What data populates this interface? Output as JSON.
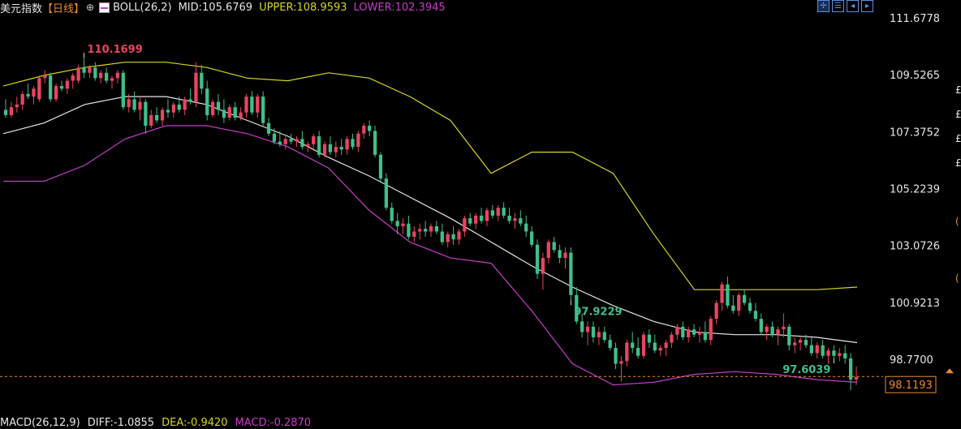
{
  "header": {
    "title": "美元指数",
    "period": "【日线】",
    "settings_icon": "settings-icon",
    "boll_icon": "boll-indicator-icon",
    "boll_label": "BOLL(26,2)",
    "mid": "MID:105.6769",
    "upper": "UPPER:108.9593",
    "lower": "LOWER:102.3945"
  },
  "toolbar": {
    "icons": [
      "crosshair-icon",
      "chart-layout-icon",
      "prev-chart-icon",
      "next-chart-icon"
    ]
  },
  "footer": {
    "macd_label": "MACD(26,12,9)",
    "diff": "DIFF:-1.0855",
    "dea": "DEA:-0.9420",
    "macd": "MACD:-0.2870"
  },
  "right_edge_glyphs": [
    "£",
    "£",
    "£",
    "£",
    "(",
    "("
  ],
  "colors": {
    "background": "#000000",
    "up_candle": "#e8455e",
    "down_candle": "#3fbf8c",
    "mid_line": "#e6e6e6",
    "upper_line": "#d8d520",
    "lower_line": "#c83cc8",
    "axis_text": "#e6e6e6",
    "high_label": "#e8455e",
    "low_label": "#3fbf8c",
    "current_price": "#e88a2a"
  },
  "chart_data": {
    "type": "candlestick",
    "y_ticks": [
      "111.6778",
      "109.5265",
      "107.3752",
      "105.2239",
      "103.0726",
      "100.9213",
      "98.7700"
    ],
    "ylim": [
      97.6,
      111.7
    ],
    "grid": false,
    "current_price": "98.1193",
    "annotations": [
      {
        "label": "110.1699",
        "bar": 14,
        "kind": "high"
      },
      {
        "label": "97.9229",
        "bar": 101,
        "kind": "low"
      },
      {
        "label": "97.6039",
        "bar": 148,
        "kind": "low"
      }
    ],
    "candles_ohlc": [
      [
        108.2,
        108.6,
        107.9,
        108.0
      ],
      [
        108.0,
        108.5,
        107.9,
        108.3
      ],
      [
        108.3,
        108.7,
        108.1,
        108.4
      ],
      [
        108.4,
        108.9,
        108.2,
        108.8
      ],
      [
        108.8,
        109.2,
        108.6,
        108.7
      ],
      [
        108.7,
        109.1,
        108.4,
        109.0
      ],
      [
        108.6,
        109.5,
        108.5,
        109.4
      ],
      [
        109.4,
        109.7,
        109.2,
        109.5
      ],
      [
        109.5,
        109.6,
        108.5,
        108.6
      ],
      [
        108.6,
        109.2,
        108.5,
        109.1
      ],
      [
        109.1,
        109.3,
        108.9,
        109.0
      ],
      [
        109.0,
        109.4,
        108.8,
        109.3
      ],
      [
        109.3,
        109.6,
        109.0,
        109.5
      ],
      [
        109.3,
        109.9,
        109.2,
        109.8
      ],
      [
        109.8,
        110.17,
        109.4,
        109.6
      ],
      [
        109.6,
        109.9,
        109.4,
        109.8
      ],
      [
        109.8,
        110.0,
        109.3,
        109.4
      ],
      [
        109.4,
        109.7,
        109.2,
        109.6
      ],
      [
        109.6,
        109.8,
        109.2,
        109.3
      ],
      [
        109.3,
        109.5,
        109.0,
        109.4
      ],
      [
        109.4,
        109.7,
        109.2,
        109.6
      ],
      [
        109.6,
        109.7,
        108.2,
        108.3
      ],
      [
        108.3,
        108.8,
        108.1,
        108.6
      ],
      [
        108.6,
        108.9,
        108.1,
        108.2
      ],
      [
        108.2,
        108.7,
        107.8,
        108.5
      ],
      [
        108.5,
        108.6,
        107.3,
        107.6
      ],
      [
        107.6,
        108.2,
        107.5,
        108.0
      ],
      [
        108.0,
        108.3,
        107.7,
        107.8
      ],
      [
        107.8,
        108.3,
        107.6,
        108.2
      ],
      [
        108.2,
        108.6,
        107.9,
        108.1
      ],
      [
        108.1,
        108.5,
        107.9,
        108.4
      ],
      [
        108.4,
        108.7,
        108.1,
        108.2
      ],
      [
        108.2,
        108.7,
        108.0,
        108.6
      ],
      [
        108.6,
        109.0,
        108.4,
        108.5
      ],
      [
        108.5,
        110.0,
        108.3,
        109.6
      ],
      [
        109.6,
        109.9,
        108.8,
        109.0
      ],
      [
        109.0,
        109.3,
        107.8,
        108.0
      ],
      [
        108.0,
        108.6,
        107.9,
        108.5
      ],
      [
        108.5,
        108.8,
        108.0,
        108.2
      ],
      [
        108.2,
        108.6,
        107.7,
        107.9
      ],
      [
        107.9,
        108.4,
        107.8,
        108.3
      ],
      [
        108.3,
        108.5,
        107.8,
        107.9
      ],
      [
        107.9,
        108.3,
        107.8,
        108.1
      ],
      [
        108.1,
        108.8,
        107.9,
        108.7
      ],
      [
        108.7,
        108.9,
        108.0,
        108.1
      ],
      [
        108.1,
        108.8,
        107.9,
        108.7
      ],
      [
        108.7,
        108.9,
        107.6,
        107.7
      ],
      [
        107.7,
        107.9,
        107.2,
        107.3
      ],
      [
        107.3,
        107.5,
        106.9,
        107.0
      ],
      [
        107.0,
        107.4,
        106.8,
        106.9
      ],
      [
        106.9,
        107.2,
        106.7,
        107.1
      ],
      [
        107.1,
        107.3,
        106.9,
        107.0
      ],
      [
        107.0,
        107.2,
        106.8,
        107.1
      ],
      [
        107.1,
        107.4,
        106.7,
        106.8
      ],
      [
        106.8,
        107.0,
        106.6,
        106.9
      ],
      [
        106.9,
        107.3,
        106.7,
        107.2
      ],
      [
        107.2,
        107.4,
        106.4,
        106.5
      ],
      [
        106.5,
        107.0,
        106.4,
        106.9
      ],
      [
        106.9,
        107.2,
        106.5,
        106.6
      ],
      [
        106.6,
        107.0,
        106.4,
        106.8
      ],
      [
        106.8,
        107.1,
        106.5,
        106.7
      ],
      [
        106.7,
        107.2,
        106.5,
        107.1
      ],
      [
        107.1,
        107.3,
        106.7,
        106.8
      ],
      [
        106.8,
        107.4,
        106.6,
        107.3
      ],
      [
        107.3,
        107.7,
        107.1,
        107.6
      ],
      [
        107.6,
        107.8,
        107.2,
        107.4
      ],
      [
        107.4,
        107.6,
        106.4,
        106.5
      ],
      [
        106.5,
        106.6,
        105.5,
        105.6
      ],
      [
        105.6,
        105.8,
        104.4,
        104.5
      ],
      [
        104.5,
        104.7,
        103.9,
        104.0
      ],
      [
        104.0,
        104.3,
        103.5,
        103.8
      ],
      [
        103.8,
        104.1,
        103.5,
        103.9
      ],
      [
        103.9,
        104.2,
        103.3,
        103.4
      ],
      [
        103.4,
        103.8,
        103.2,
        103.6
      ],
      [
        103.6,
        103.9,
        103.3,
        103.7
      ],
      [
        103.7,
        104.0,
        103.4,
        103.6
      ],
      [
        103.6,
        103.9,
        103.4,
        103.8
      ],
      [
        103.8,
        104.0,
        103.5,
        103.6
      ],
      [
        103.6,
        103.9,
        103.1,
        103.2
      ],
      [
        103.2,
        103.6,
        103.0,
        103.5
      ],
      [
        103.5,
        103.8,
        103.1,
        103.3
      ],
      [
        103.3,
        103.7,
        103.1,
        103.6
      ],
      [
        103.6,
        104.2,
        103.4,
        104.1
      ],
      [
        104.1,
        104.3,
        103.8,
        103.9
      ],
      [
        103.9,
        104.3,
        103.7,
        104.2
      ],
      [
        104.2,
        104.5,
        103.9,
        104.0
      ],
      [
        104.0,
        104.5,
        103.8,
        104.4
      ],
      [
        104.4,
        104.6,
        104.1,
        104.2
      ],
      [
        104.2,
        104.6,
        104.0,
        104.5
      ],
      [
        104.5,
        104.7,
        104.1,
        104.2
      ],
      [
        104.2,
        104.5,
        103.9,
        104.0
      ],
      [
        104.0,
        104.3,
        103.7,
        104.1
      ],
      [
        104.1,
        104.4,
        103.8,
        103.9
      ],
      [
        103.9,
        104.2,
        103.4,
        103.6
      ],
      [
        103.6,
        103.8,
        103.0,
        103.1
      ],
      [
        103.1,
        103.3,
        101.8,
        102.0
      ],
      [
        102.0,
        102.8,
        101.4,
        102.6
      ],
      [
        102.6,
        103.3,
        102.4,
        103.2
      ],
      [
        103.2,
        103.4,
        102.8,
        102.9
      ],
      [
        102.9,
        103.1,
        102.4,
        102.6
      ],
      [
        102.6,
        103.0,
        102.2,
        102.8
      ],
      [
        102.8,
        103.0,
        101.0,
        101.2
      ],
      [
        101.2,
        101.5,
        100.1,
        100.2
      ],
      [
        100.2,
        100.5,
        99.6,
        99.8
      ],
      [
        99.8,
        100.2,
        99.3,
        100.0
      ],
      [
        100.0,
        100.2,
        99.4,
        99.6
      ],
      [
        99.6,
        100.0,
        99.3,
        99.8
      ],
      [
        99.8,
        100.0,
        99.4,
        99.5
      ],
      [
        99.5,
        99.7,
        99.1,
        99.2
      ],
      [
        99.2,
        99.4,
        98.4,
        98.6
      ],
      [
        98.6,
        98.9,
        97.92,
        98.7
      ],
      [
        98.7,
        99.5,
        98.5,
        99.4
      ],
      [
        99.4,
        99.8,
        99.0,
        99.2
      ],
      [
        99.2,
        99.6,
        98.8,
        98.9
      ],
      [
        98.9,
        99.8,
        98.8,
        99.7
      ],
      [
        99.7,
        99.9,
        99.2,
        99.4
      ],
      [
        99.4,
        99.7,
        99.0,
        99.1
      ],
      [
        99.1,
        99.3,
        98.9,
        99.2
      ],
      [
        99.2,
        99.5,
        98.9,
        99.4
      ],
      [
        99.4,
        99.8,
        99.2,
        99.7
      ],
      [
        99.7,
        100.1,
        99.5,
        100.0
      ],
      [
        100.0,
        100.2,
        99.5,
        99.6
      ],
      [
        99.6,
        100.0,
        99.4,
        99.9
      ],
      [
        99.9,
        100.1,
        99.6,
        99.7
      ],
      [
        99.7,
        100.0,
        99.4,
        99.8
      ],
      [
        99.8,
        100.2,
        99.4,
        99.5
      ],
      [
        99.5,
        100.4,
        99.3,
        100.3
      ],
      [
        100.3,
        101.0,
        100.1,
        100.9
      ],
      [
        100.9,
        101.7,
        100.6,
        101.6
      ],
      [
        101.6,
        101.9,
        100.7,
        100.8
      ],
      [
        100.8,
        101.2,
        100.5,
        100.6
      ],
      [
        100.6,
        101.3,
        100.4,
        101.2
      ],
      [
        101.2,
        101.4,
        100.8,
        100.9
      ],
      [
        100.9,
        101.1,
        100.5,
        100.6
      ],
      [
        100.6,
        100.9,
        100.2,
        100.3
      ],
      [
        100.3,
        100.5,
        99.7,
        99.8
      ],
      [
        99.8,
        100.1,
        99.5,
        100.0
      ],
      [
        100.0,
        100.2,
        99.6,
        99.7
      ],
      [
        99.7,
        100.0,
        99.3,
        99.9
      ],
      [
        99.9,
        100.5,
        99.6,
        100.0
      ],
      [
        100.0,
        100.1,
        99.1,
        99.3
      ],
      [
        99.3,
        99.6,
        99.0,
        99.4
      ],
      [
        99.4,
        99.6,
        99.1,
        99.5
      ],
      [
        99.5,
        99.7,
        99.2,
        99.3
      ],
      [
        99.3,
        99.6,
        98.9,
        99.0
      ],
      [
        99.0,
        99.4,
        98.8,
        99.3
      ],
      [
        99.3,
        99.5,
        98.8,
        98.9
      ],
      [
        98.9,
        99.2,
        98.6,
        99.1
      ],
      [
        99.1,
        99.3,
        98.8,
        98.9
      ],
      [
        98.9,
        99.2,
        98.7,
        99.0
      ],
      [
        99.0,
        99.3,
        98.6,
        98.8
      ],
      [
        98.8,
        99.0,
        97.6,
        98.0
      ],
      [
        98.0,
        98.5,
        97.8,
        98.1
      ]
    ],
    "series": [
      {
        "name": "MID",
        "color": "#e6e6e6",
        "points": [
          [
            0,
            107.3
          ],
          [
            10,
            107.7
          ],
          [
            20,
            108.4
          ],
          [
            30,
            108.7
          ],
          [
            40,
            108.7
          ],
          [
            50,
            108.4
          ],
          [
            60,
            107.8
          ],
          [
            70,
            107.2
          ],
          [
            80,
            106.4
          ],
          [
            90,
            105.7
          ],
          [
            100,
            104.9
          ],
          [
            110,
            104.1
          ],
          [
            120,
            103.2
          ],
          [
            130,
            102.3
          ],
          [
            140,
            101.5
          ],
          [
            150,
            100.8
          ],
          [
            160,
            100.2
          ],
          [
            170,
            99.8
          ],
          [
            180,
            99.7
          ],
          [
            190,
            99.7
          ],
          [
            200,
            99.6
          ],
          [
            210,
            99.4
          ]
        ]
      },
      {
        "name": "UPPER",
        "color": "#d8d520",
        "points": [
          [
            0,
            109.1
          ],
          [
            10,
            109.5
          ],
          [
            20,
            109.8
          ],
          [
            30,
            110.0
          ],
          [
            40,
            110.0
          ],
          [
            50,
            109.8
          ],
          [
            60,
            109.4
          ],
          [
            70,
            109.3
          ],
          [
            80,
            109.6
          ],
          [
            90,
            109.4
          ],
          [
            100,
            108.7
          ],
          [
            110,
            107.8
          ],
          [
            120,
            105.8
          ],
          [
            130,
            106.6
          ],
          [
            140,
            106.6
          ],
          [
            150,
            105.8
          ],
          [
            160,
            103.5
          ],
          [
            170,
            101.4
          ],
          [
            180,
            101.4
          ],
          [
            190,
            101.4
          ],
          [
            200,
            101.4
          ],
          [
            210,
            101.5
          ]
        ]
      },
      {
        "name": "LOWER",
        "color": "#c83cc8",
        "points": [
          [
            0,
            105.5
          ],
          [
            10,
            105.5
          ],
          [
            20,
            106.1
          ],
          [
            30,
            107.1
          ],
          [
            40,
            107.6
          ],
          [
            50,
            107.6
          ],
          [
            60,
            107.3
          ],
          [
            70,
            106.8
          ],
          [
            80,
            106.0
          ],
          [
            90,
            104.4
          ],
          [
            100,
            103.2
          ],
          [
            110,
            102.6
          ],
          [
            120,
            102.4
          ],
          [
            130,
            100.6
          ],
          [
            140,
            98.6
          ],
          [
            150,
            97.8
          ],
          [
            160,
            97.9
          ],
          [
            170,
            98.2
          ],
          [
            180,
            98.3
          ],
          [
            190,
            98.2
          ],
          [
            200,
            98.0
          ],
          [
            210,
            97.9
          ]
        ]
      }
    ]
  }
}
